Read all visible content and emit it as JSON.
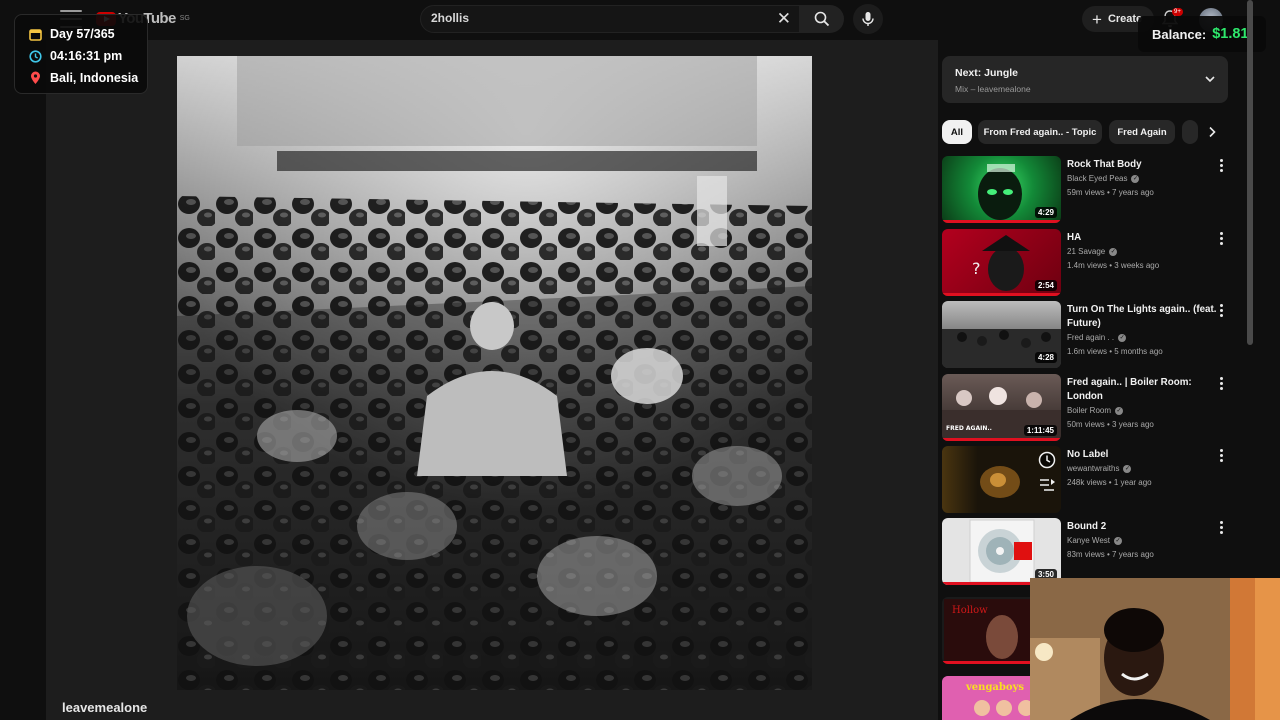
{
  "overlay": {
    "day": "Day 57/365",
    "time": "04:16:31 pm",
    "location": "Bali, Indonesia",
    "balance_label": "Balance:",
    "balance_value": "$1.81",
    "colors": {
      "balance": "#2ee86c",
      "calendar": "#f5c542",
      "clock": "#3fc6e8",
      "pin": "#ff4b4b"
    }
  },
  "header": {
    "logo_text": "YouTube",
    "logo_suffix": "SG",
    "search_value": "2hollis",
    "create_label": "Create",
    "notification_badge": "9+",
    "icons": [
      "menu-icon",
      "search-icon",
      "mic-icon",
      "close-icon",
      "plus-icon",
      "bell-icon"
    ]
  },
  "player": {
    "channel": "leavemealone"
  },
  "up_next": {
    "title": "Next: Jungle",
    "subtitle": "Mix – leavemealone"
  },
  "chips": [
    "All",
    "From Fred again.. - Topic",
    "Fred Again",
    ""
  ],
  "videos": [
    {
      "title": "Rock That Body",
      "channel": "Black Eyed Peas",
      "verified": true,
      "meta": "59m views • 7 years ago",
      "duration": "4:29"
    },
    {
      "title": "HA",
      "channel": "21 Savage",
      "verified": true,
      "meta": "1.4m views • 3 weeks ago",
      "duration": "2:54"
    },
    {
      "title": "Turn On The Lights again.. (feat. Future)",
      "channel": "Fred again . .",
      "verified": true,
      "meta": "1.6m views • 5 months ago",
      "duration": "4:28"
    },
    {
      "title": "Fred again.. | Boiler Room: London",
      "channel": "Boiler Room",
      "verified": true,
      "meta": "50m views • 3 years ago",
      "duration": "1:11:45",
      "thumb_text": "FRED AGAIN.."
    },
    {
      "title": "No Label",
      "channel": "wewantwraiths",
      "verified": true,
      "meta": "248k views • 1 year ago",
      "duration": ""
    },
    {
      "title": "Bound 2",
      "channel": "Kanye West",
      "verified": true,
      "meta": "83m views • 7 years ago",
      "duration": "3:50"
    }
  ],
  "partial_thumbs": [
    {
      "thumb_text": "Hollow"
    },
    {
      "thumb_text": "vengaboys"
    }
  ]
}
